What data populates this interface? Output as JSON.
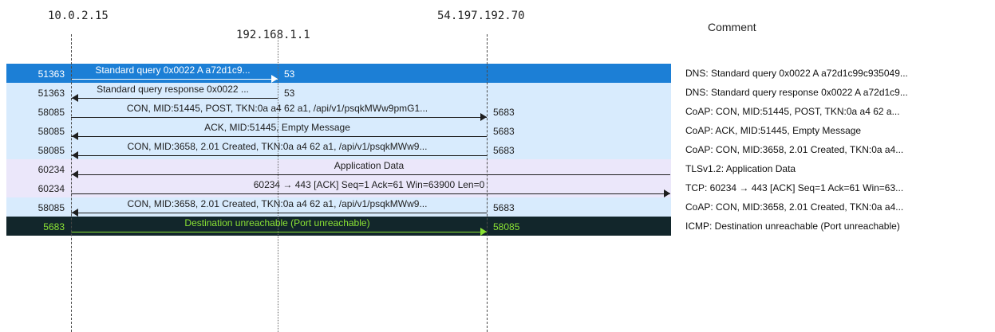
{
  "headers": {
    "hosts": [
      "10.0.2.15",
      "192.168.1.1",
      "54.197.192.70"
    ],
    "comment": "Comment"
  },
  "colors": {
    "selected": "#1c7fd6",
    "dns": "#d8ebfd",
    "coap": "#d8ebfd",
    "tls": "#ebe7fa",
    "tcp": "#ebe7fa",
    "icmp": "#12262b",
    "icmp_text": "#8ae234"
  },
  "rows": [
    {
      "src_port": "51363",
      "dst_port": "53",
      "label": "Standard query 0x0022 A a72d1c9...",
      "dir": "right",
      "span": "a-b",
      "style": "selected",
      "comment": "DNS: Standard query 0x0022 A a72d1c99c935049..."
    },
    {
      "src_port": "51363",
      "dst_port": "53",
      "label": "Standard query response 0x0022 ...",
      "dir": "left",
      "span": "a-b",
      "style": "dns",
      "comment": "DNS: Standard query response 0x0022 A a72d1c9..."
    },
    {
      "src_port": "58085",
      "dst_port": "5683",
      "label": "CON, MID:51445, POST, TKN:0a a4 62 a1, /api/v1/psqkMWw9pmG1...",
      "dir": "right",
      "span": "a-c",
      "style": "coap",
      "comment": "CoAP: CON, MID:51445, POST, TKN:0a a4 62 a..."
    },
    {
      "src_port": "58085",
      "dst_port": "5683",
      "label": "ACK, MID:51445, Empty Message",
      "dir": "left",
      "span": "a-c",
      "style": "coap",
      "comment": "CoAP: ACK, MID:51445, Empty Message"
    },
    {
      "src_port": "58085",
      "dst_port": "5683",
      "label": "CON, MID:3658, 2.01 Created, TKN:0a a4 62 a1, /api/v1/psqkMWw9...",
      "dir": "left",
      "span": "a-c",
      "style": "coap",
      "comment": "CoAP: CON, MID:3658, 2.01 Created, TKN:0a a4..."
    },
    {
      "src_port": "60234",
      "dst_port": "",
      "label": "Application Data",
      "dir": "left",
      "span": "a-edge",
      "style": "tls",
      "comment": "TLSv1.2: Application Data"
    },
    {
      "src_port": "60234",
      "dst_port": "",
      "label": "60234 → 443 [ACK] Seq=1 Ack=61 Win=63900 Len=0",
      "dir": "right",
      "span": "a-edge",
      "style": "tcp",
      "comment": "TCP: 60234 → 443 [ACK] Seq=1 Ack=61 Win=63..."
    },
    {
      "src_port": "58085",
      "dst_port": "5683",
      "label": "CON, MID:3658, 2.01 Created, TKN:0a a4 62 a1, /api/v1/psqkMWw9...",
      "dir": "left",
      "span": "a-c",
      "style": "coap",
      "comment": "CoAP: CON, MID:3658, 2.01 Created, TKN:0a a4..."
    },
    {
      "src_port": "5683",
      "dst_port": "58085",
      "label": "Destination unreachable (Port unreachable)",
      "dir": "right",
      "span": "a-c",
      "style": "icmp",
      "comment": "ICMP: Destination unreachable (Port unreachable)"
    }
  ]
}
